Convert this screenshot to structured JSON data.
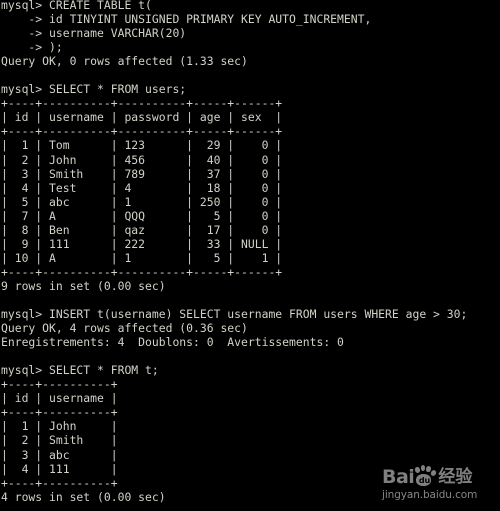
{
  "terminal": {
    "prompt": "mysql>",
    "continuation_prompt": "    ->",
    "foreground_color": "#d2d2c8",
    "background_color": "#000000",
    "lines": [
      "mysql> CREATE TABLE t(",
      "    -> id TINYINT UNSIGNED PRIMARY KEY AUTO_INCREMENT,",
      "    -> username VARCHAR(20)",
      "    -> );",
      "Query OK, 0 rows affected (1.33 sec)",
      "",
      "mysql> SELECT * FROM users;",
      "+----+----------+----------+-----+------+",
      "| id | username | password | age | sex  |",
      "+----+----------+----------+-----+------+",
      "|  1 | Tom      | 123      |  29 |    0 |",
      "|  2 | John     | 456      |  40 |    0 |",
      "|  3 | Smith    | 789      |  37 |    0 |",
      "|  4 | Test     | 4        |  18 |    0 |",
      "|  5 | abc      | 1        | 250 |    0 |",
      "|  7 | A        | QQQ      |   5 |    0 |",
      "|  8 | Ben      | qaz      |  17 |    0 |",
      "|  9 | 111      | 222      |  33 | NULL |",
      "| 10 | A        | 1        |   5 |    1 |",
      "+----+----------+----------+-----+------+",
      "9 rows in set (0.00 sec)",
      "",
      "mysql> INSERT t(username) SELECT username FROM users WHERE age > 30;",
      "Query OK, 4 rows affected (0.36 sec)",
      "Enregistrements: 4  Doublons: 0  Avertissements: 0",
      "",
      "mysql> SELECT * FROM t;",
      "+----+----------+",
      "| id | username |",
      "+----+----------+",
      "|  1 | John     |",
      "|  2 | Smith    |",
      "|  3 | abc      |",
      "|  4 | 111      |",
      "+----+----------+",
      "4 rows in set (0.00 sec)"
    ],
    "commands": [
      {
        "statement": "CREATE TABLE t(",
        "continuations": [
          "id TINYINT UNSIGNED PRIMARY KEY AUTO_INCREMENT,",
          "username VARCHAR(20)",
          ");"
        ],
        "result": "Query OK, 0 rows affected (1.33 sec)"
      },
      {
        "statement": "SELECT * FROM users;",
        "result": "9 rows in set (0.00 sec)"
      },
      {
        "statement": "INSERT t(username) SELECT username FROM users WHERE age > 30;",
        "result": "Query OK, 4 rows affected (0.36 sec)",
        "extra": "Enregistrements: 4  Doublons: 0  Avertissements: 0"
      },
      {
        "statement": "SELECT * FROM t;",
        "result": "4 rows in set (0.00 sec)"
      }
    ],
    "result_tables": [
      {
        "name": "users",
        "columns": [
          "id",
          "username",
          "password",
          "age",
          "sex"
        ],
        "rows": [
          [
            "1",
            "Tom",
            "123",
            "29",
            "0"
          ],
          [
            "2",
            "John",
            "456",
            "40",
            "0"
          ],
          [
            "3",
            "Smith",
            "789",
            "37",
            "0"
          ],
          [
            "4",
            "Test",
            "4",
            "18",
            "0"
          ],
          [
            "5",
            "abc",
            "1",
            "250",
            "0"
          ],
          [
            "7",
            "A",
            "QQQ",
            "5",
            "0"
          ],
          [
            "8",
            "Ben",
            "qaz",
            "17",
            "0"
          ],
          [
            "9",
            "111",
            "222",
            "33",
            "NULL"
          ],
          [
            "10",
            "A",
            "1",
            "5",
            "1"
          ]
        ],
        "row_count_text": "9 rows in set (0.00 sec)"
      },
      {
        "name": "t",
        "columns": [
          "id",
          "username"
        ],
        "rows": [
          [
            "1",
            "John"
          ],
          [
            "2",
            "Smith"
          ],
          [
            "3",
            "abc"
          ],
          [
            "4",
            "111"
          ]
        ],
        "row_count_text": "4 rows in set (0.00 sec)"
      }
    ]
  },
  "watermark": {
    "brand_latin": "Bai",
    "brand_mark": "du",
    "brand_cn": "经验",
    "url": "jingyan.baidu.com",
    "color": "#cfcfcf"
  }
}
